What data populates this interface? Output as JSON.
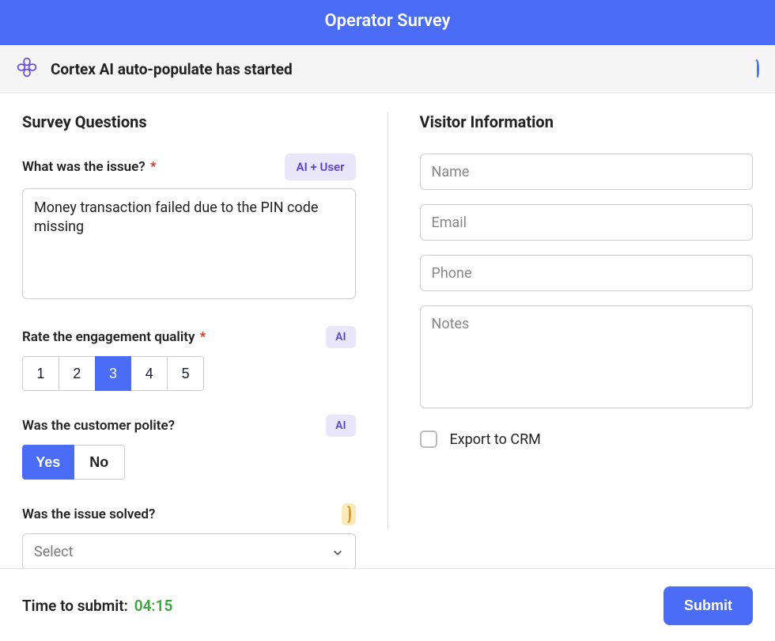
{
  "header": {
    "title": "Operator Survey"
  },
  "banner": {
    "text": "Cortex AI auto-populate has started"
  },
  "survey": {
    "title": "Survey Questions",
    "q1": {
      "label": "What was the issue?",
      "required": "*",
      "badge": "AI + User",
      "value": "Money transaction failed due to the PIN code missing"
    },
    "q2": {
      "label": "Rate the engagement quality",
      "required": "*",
      "badge": "AI",
      "options": [
        "1",
        "2",
        "3",
        "4",
        "5"
      ],
      "selected": "3"
    },
    "q3": {
      "label": "Was the customer polite?",
      "badge": "AI",
      "options": {
        "yes": "Yes",
        "no": "No"
      },
      "selected": "Yes"
    },
    "q4": {
      "label": "Was the issue solved?",
      "select_value": "Select"
    }
  },
  "visitor": {
    "title": "Visitor Information",
    "name_ph": "Name",
    "email_ph": "Email",
    "phone_ph": "Phone",
    "notes_ph": "Notes",
    "export_label": "Export to CRM"
  },
  "footer": {
    "timer_label": "Time to submit:",
    "timer_value": "04:15",
    "submit_label": "Submit"
  }
}
